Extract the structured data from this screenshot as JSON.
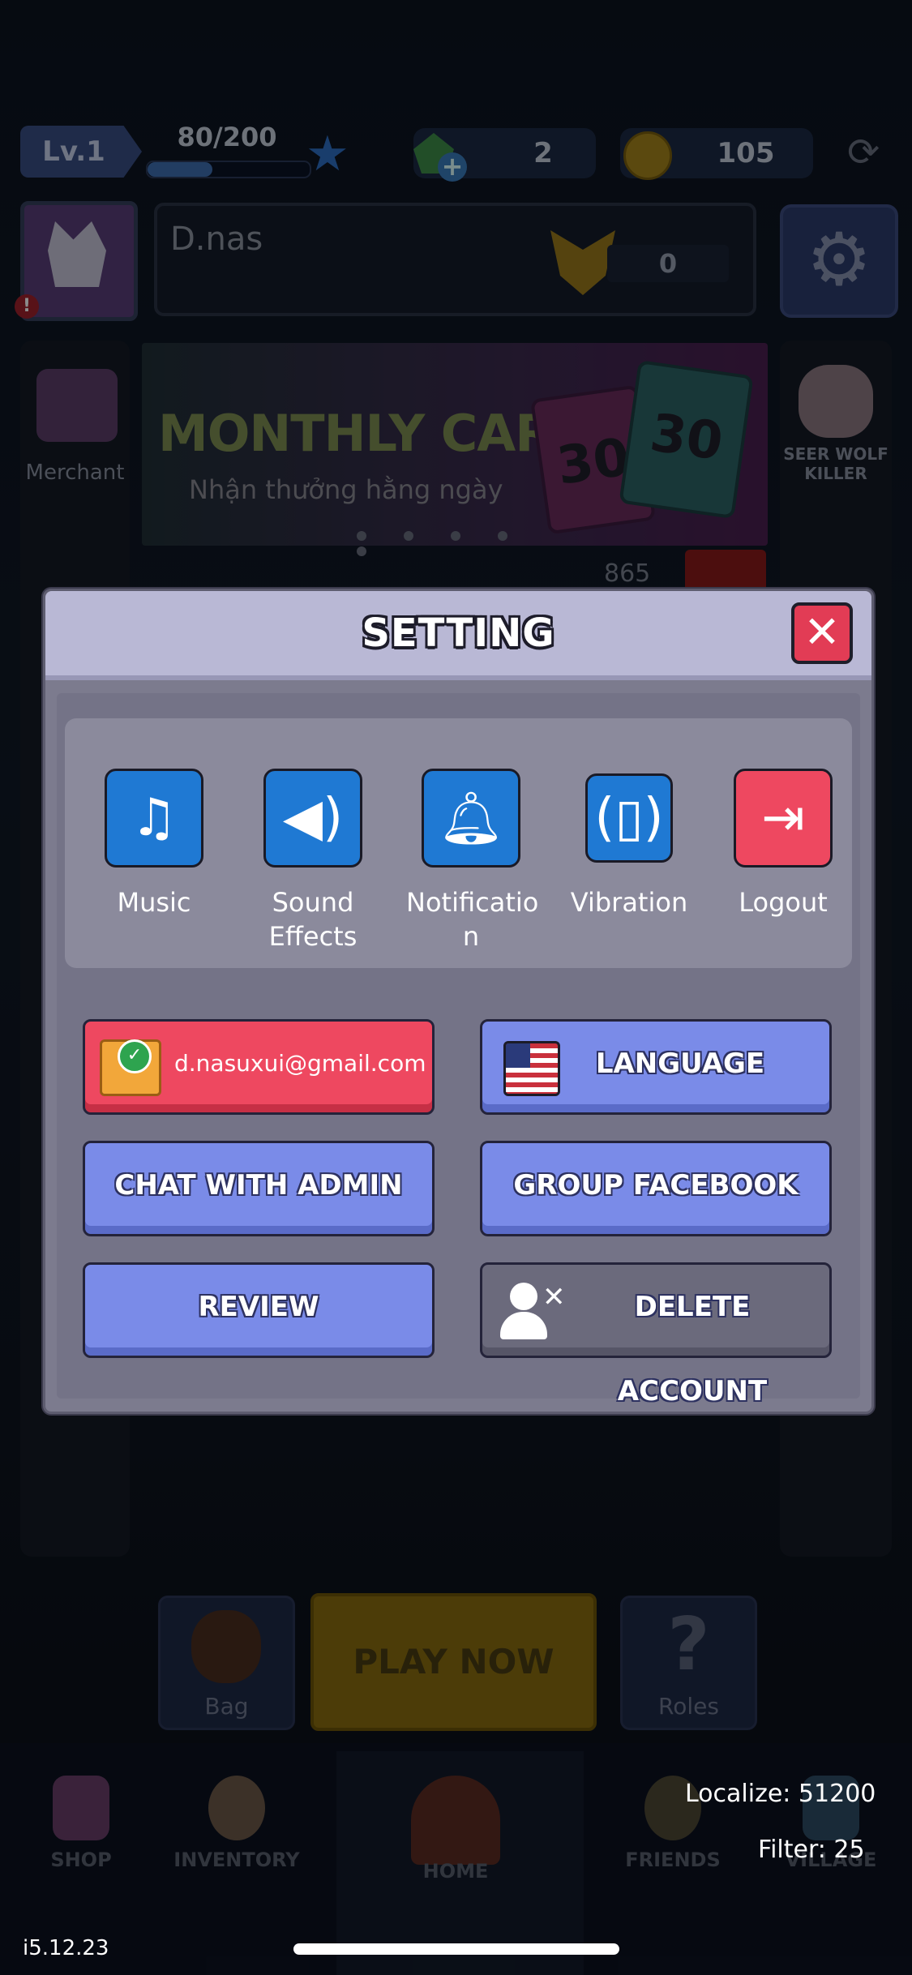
{
  "hud": {
    "level": "Lv.1",
    "xp_text": "80/200",
    "xp_progress": 0.4,
    "gems": "2",
    "coins": "105"
  },
  "profile": {
    "name": "D.nas",
    "rank_points": "0"
  },
  "banner": {
    "title": "MONTHLY CARD",
    "subtitle": "Nhận thưởng hằng ngày",
    "card_value_1": "30",
    "card_value_2": "30"
  },
  "sidebar": {
    "merchant_label": "Merchant",
    "seer_label_1": "SEER WOLF",
    "seer_label_2": "KILLER"
  },
  "leaderboard_count": "865",
  "setting": {
    "title": "SETTING",
    "items": [
      {
        "label_1": "Music",
        "label_2": "",
        "icon": "music-note-icon"
      },
      {
        "label_1": "Sound",
        "label_2": "Effects",
        "icon": "speaker-icon"
      },
      {
        "label_1": "Notificatio",
        "label_2": "n",
        "icon": "bell-icon"
      },
      {
        "label_1": "Vibration",
        "label_2": "",
        "icon": "vibration-icon"
      },
      {
        "label_1": "Logout",
        "label_2": "",
        "icon": "logout-icon"
      }
    ],
    "email": "d.nasuxui@gmail.com",
    "language_label": "LANGUAGE",
    "chat_admin_label": "CHAT WITH ADMIN",
    "group_facebook_label": "GROUP FACEBOOK",
    "review_label": "REVIEW",
    "delete_account_label": "DELETE ACCOUNT"
  },
  "bottom": {
    "bag_label": "Bag",
    "play_label": "PLAY NOW",
    "roles_label": "Roles",
    "nav": [
      "SHOP",
      "INVENTORY",
      "HOME",
      "FRIENDS",
      "VILLAGE"
    ]
  },
  "debug": {
    "localize": "Localize: 51200",
    "filter": "Filter: 25",
    "version": "i5.12.23"
  },
  "colors": {
    "accent_blue": "#1f79d3",
    "danger_red": "#ee4860",
    "button_periwinkle": "#7a8be8",
    "dialog_header": "#b9b8d5"
  }
}
